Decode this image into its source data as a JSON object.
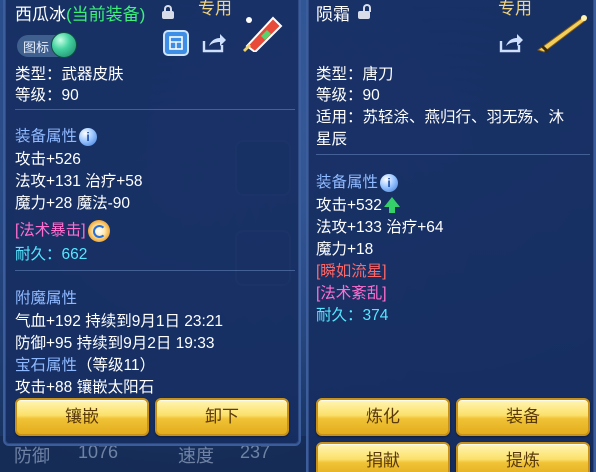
{
  "background": {
    "bottom_left_label": "防御",
    "bottom_left_value": "1076",
    "bottom_mid_label": "速度",
    "bottom_mid_value": "237"
  },
  "left_panel": {
    "title_name": "西瓜冰",
    "title_status": "(当前装备)",
    "tag": "专用",
    "badge_label": "图标",
    "type_line": "类型：武器皮肤",
    "level_line": "等级：90",
    "equip_attr_header": "装备属性",
    "attack_line": "攻击+526",
    "magic_heal_line": "法攻+131 治疗+58",
    "power_line": "魔力+28 魔法-90",
    "skill_line": "[法术暴击]",
    "durability_line": "耐久：662",
    "enchant_header": "附魔属性",
    "enchant_line_1": "气血+192 持续到9月1日 23:21",
    "enchant_line_2": "防御+95 持续到9月2日 19:33",
    "gem_header": "宝石属性",
    "gem_level": "（等级11）",
    "gem_line": "攻击+88 镶嵌太阳石",
    "buttons": {
      "inlay": "镶嵌",
      "unequip": "卸下"
    }
  },
  "right_panel": {
    "title_name": "陨霜",
    "tag": "专用",
    "type_line": "类型：唐刀",
    "level_line": "等级：90",
    "applicable_line_1": "适用：苏轻涂、燕归行、羽无殇、沐",
    "applicable_line_2": "星辰",
    "equip_attr_header": "装备属性",
    "attack_line": "攻击+532",
    "magic_heal_line": "法攻+133 治疗+64",
    "power_line": "魔力+18",
    "skill_line_1": "[瞬如流星]",
    "skill_line_2": "[法术紊乱]",
    "durability_line": "耐久：374",
    "buttons": {
      "refine": "炼化",
      "equip": "装备",
      "donate": "捐献",
      "extract": "提炼"
    }
  },
  "colors": {
    "equipped_green": "#3cf07a",
    "section_blue": "#8fb9ff",
    "skill_pink": "#ff6fd0",
    "skill_red": "#ff6767",
    "durability_cyan": "#56e6ff",
    "button_gold": "#f0c236"
  }
}
